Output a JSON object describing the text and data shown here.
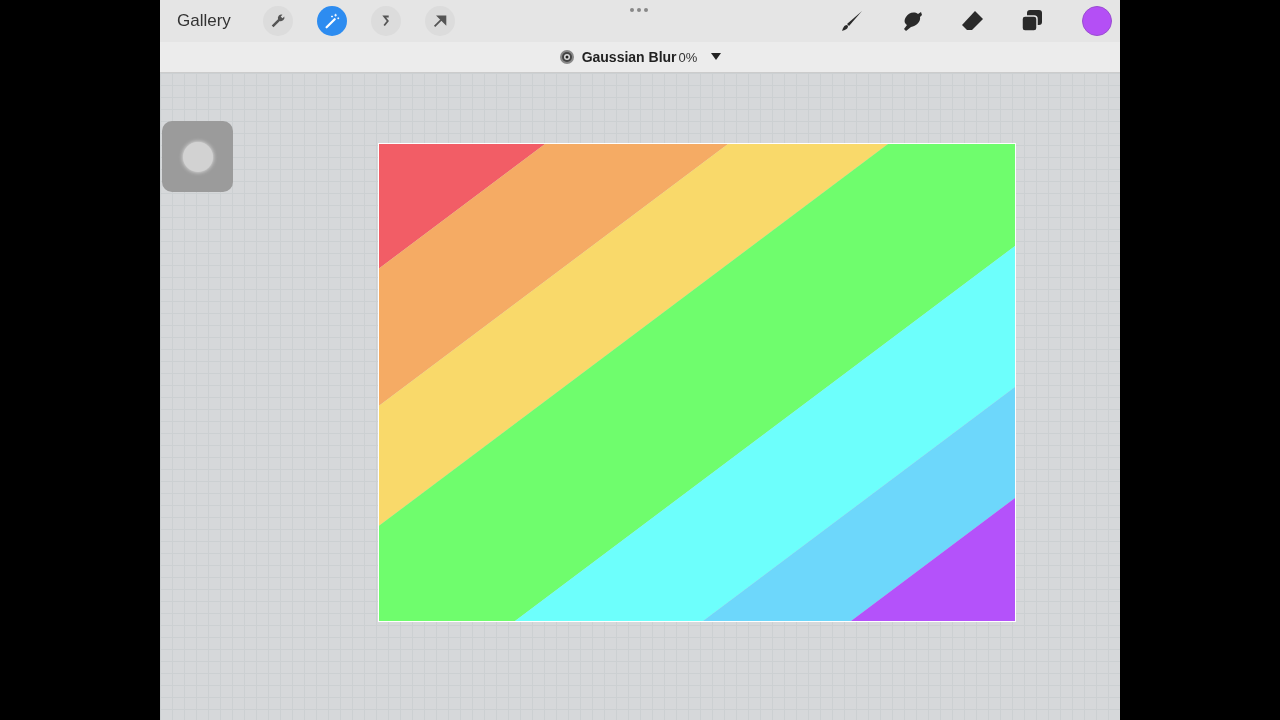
{
  "toolbar": {
    "gallery": "Gallery",
    "tools": [
      {
        "kind": "wrench",
        "selected": false
      },
      {
        "kind": "wand",
        "selected": true
      },
      {
        "kind": "selection",
        "selected": false
      },
      {
        "kind": "transform",
        "selected": false
      }
    ],
    "painting_tools": [
      {
        "kind": "brush",
        "selected": false
      },
      {
        "kind": "smudge",
        "selected": false
      },
      {
        "kind": "eraser",
        "selected": false
      },
      {
        "kind": "layers",
        "selected": false
      }
    ]
  },
  "adjustment": {
    "name": "Gaussian Blur",
    "value": "0%"
  }
}
